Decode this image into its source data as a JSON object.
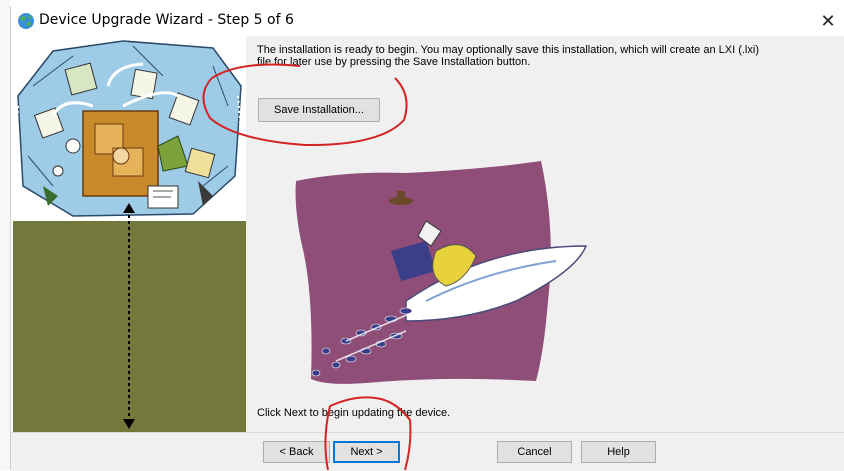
{
  "window": {
    "title": "Device Upgrade Wizard - Step 5 of 6",
    "close_glyph": "✕"
  },
  "content": {
    "intro_line1": "The installation is ready to begin.  You may optionally save this installation, which will create an LXI (.lxi)",
    "intro_line2": "file  for later use by pressing the Save Installation button.",
    "save_button": "Save Installation...",
    "footer": "Click Next to begin updating the device."
  },
  "buttons": {
    "back": "< Back",
    "next": "Next >",
    "cancel": "Cancel",
    "help": "Help"
  },
  "icons": {
    "app": "globe-icon",
    "close": "close-icon"
  },
  "colors": {
    "sidebar_olive": "#75783b",
    "rocket_backdrop": "#8e4e78",
    "annotation_red": "#d42323",
    "focus_blue": "#0078d7"
  }
}
